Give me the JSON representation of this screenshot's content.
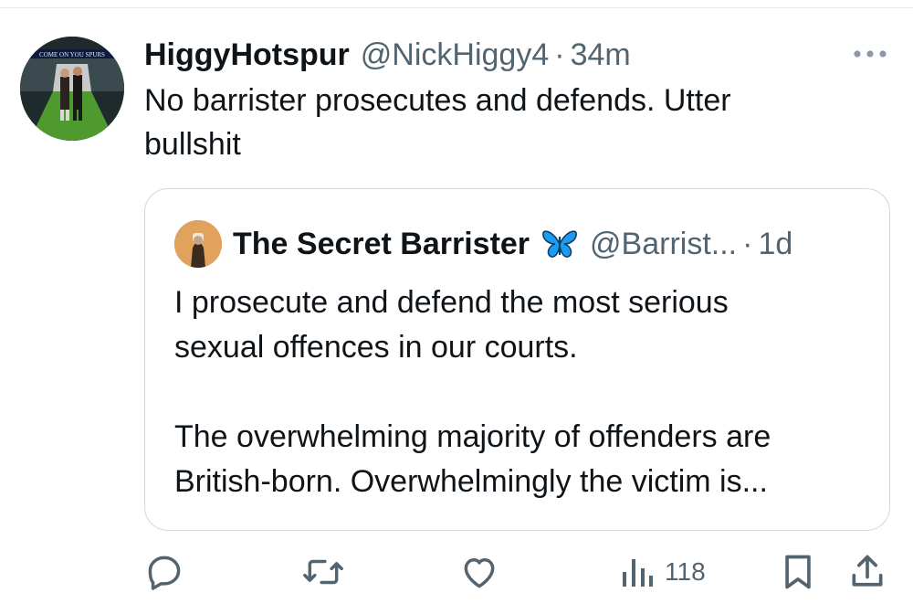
{
  "tweet": {
    "author_name": "HiggyHotspur",
    "author_handle": "@NickHiggy4",
    "separator": "·",
    "time": "34m",
    "text_lines": [
      "No barrister prosecutes and defends. Utter",
      "bullshit"
    ],
    "avatar_banner_text": "COME ON YOU SPURS"
  },
  "quoted": {
    "author_name": "The Secret Barrister",
    "author_handle": "@Barrist...",
    "separator": "·",
    "time": "1d",
    "text_lines": [
      "I prosecute and defend the most serious",
      "sexual offences in our courts."
    ],
    "text_lines_2": [
      "The overwhelming majority of offenders are",
      "British-born. Overwhelmingly the victim is..."
    ]
  },
  "actions": {
    "views": "118"
  },
  "icons": [
    "more-icon",
    "reply-icon",
    "retweet-icon",
    "like-icon",
    "views-icon",
    "bookmark-icon",
    "share-icon",
    "butterfly-icon"
  ],
  "colors": {
    "text": "#0f1419",
    "muted": "#536471",
    "border": "#cfd9de",
    "butterfly": "#1d9bf0"
  }
}
